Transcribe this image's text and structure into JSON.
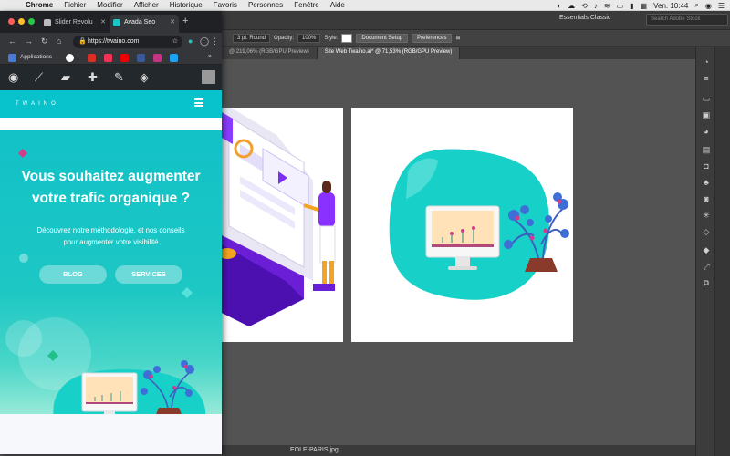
{
  "menubar": {
    "items": [
      "Chrome",
      "Fichier",
      "Modifier",
      "Afficher",
      "Historique",
      "Favoris",
      "Personnes",
      "Fenêtre",
      "Aide"
    ],
    "clock": "Ven. 10:44"
  },
  "illustrator": {
    "workspace": "Essentials Classic",
    "search_placeholder": "Search Adobe Stock",
    "stroke_profile": "3 pt. Round",
    "opacity_label": "Opacity:",
    "opacity_value": "100%",
    "style_label": "Style:",
    "document_setup": "Document Setup",
    "preferences": "Preferences",
    "tabs": [
      "@ 219,06% (RGB/GPU Preview)",
      "Site Web Twaino.ai* @ 71,53% (RGB/GPU Preview)"
    ],
    "bottom_file": "EOLE-PARIS.jpg"
  },
  "chrome": {
    "tabs": [
      {
        "title": "Slider Revolu",
        "active": false
      },
      {
        "title": "Avada Seo",
        "active": true
      }
    ],
    "url": "https://twaino.com",
    "bookmarks_label": "Applications",
    "bookmarks_more": "»"
  },
  "site": {
    "logo": "TWAINO",
    "headline_line1": "Vous souhaitez augmenter",
    "headline_line2": "votre trafic organique ?",
    "sub_line1": "Découvrez notre méthodologie, et nos conseils",
    "sub_line2": "pour augmenter votre visibilité",
    "btn_blog": "BLOG",
    "btn_services": "SERVICES"
  },
  "colors": {
    "teal": "#0fc0c8",
    "turquoise_blob": "#17d1c8",
    "purple": "#7b2ff2",
    "wp_bar": "#23282d"
  }
}
